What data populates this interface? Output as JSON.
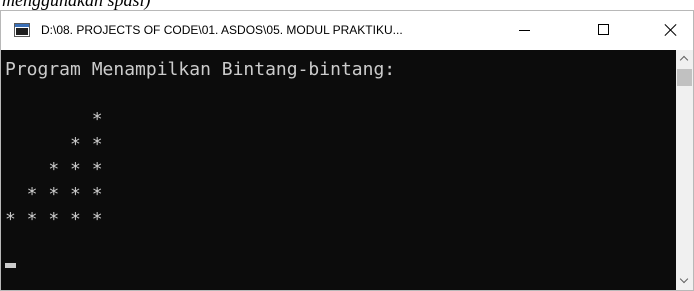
{
  "document": {
    "fragment_text": "menggunakan spasi)"
  },
  "window": {
    "title": "D:\\08. PROJECTS OF CODE\\01. ASDOS\\05. MODUL PRAKTIKU...",
    "icon": "console-app-icon",
    "controls": {
      "minimize_icon": "minimize-icon",
      "maximize_icon": "maximize-icon",
      "close_icon": "close-icon"
    }
  },
  "console": {
    "background_color": "#0c0c0c",
    "text_color": "#cccccc",
    "lines": [
      "Program Menampilkan Bintang-bintang:",
      "",
      "        *",
      "      * *",
      "    * * *",
      "  * * * *",
      "* * * * *"
    ],
    "cursor": "block-cursor"
  },
  "scrollbar": {
    "up_icon": "scroll-up-arrow-icon",
    "down_icon": "scroll-down-arrow-icon"
  }
}
